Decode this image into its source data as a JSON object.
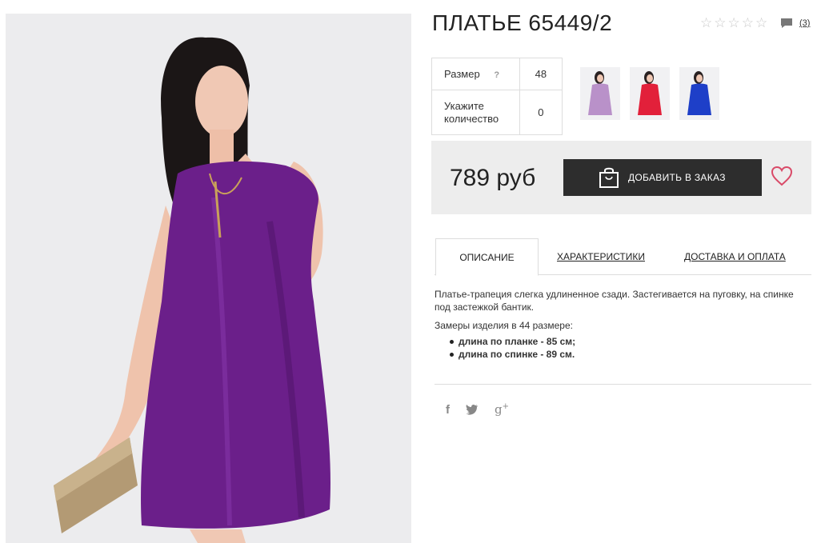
{
  "product": {
    "title": "ПЛАТЬЕ 65449/2",
    "rating_icons": [
      "star-empty",
      "star-empty",
      "star-empty",
      "star-empty",
      "star-empty"
    ],
    "reviews_count": "(3)"
  },
  "options": {
    "size_label": "Размер",
    "size_help": "?",
    "size_value": "48",
    "qty_label": "Укажите количество",
    "qty_value": "0"
  },
  "thumbnails": [
    {
      "name": "lilac",
      "color": "#b991c9"
    },
    {
      "name": "red",
      "color": "#e2203a"
    },
    {
      "name": "blue",
      "color": "#1e3fc8"
    }
  ],
  "buy": {
    "price": "789 руб",
    "button_label": "ДОБАВИТЬ В ЗАКАЗ",
    "wishlist_icon": "heart-icon",
    "accent_color": "#d94a68"
  },
  "tabs": [
    {
      "label": "ОПИСАНИЕ",
      "active": true
    },
    {
      "label": "ХАРАКТЕРИСТИКИ",
      "active": false
    },
    {
      "label": "ДОСТАВКА И ОПЛАТА",
      "active": false
    }
  ],
  "description": {
    "text": "Платье-трапеция слегка удлиненное сзади. Застегивается на пуговку, на спинке под застежкой бантик.",
    "measurements_title": "Замеры изделия в 44 размере:",
    "measurements": [
      "длина по планке - 85 см;",
      "длина по спинке - 89 см."
    ]
  },
  "social": [
    {
      "name": "facebook-icon",
      "glyph": "f"
    },
    {
      "name": "twitter-icon",
      "glyph": "🐦"
    },
    {
      "name": "google-plus-icon",
      "glyph": "g+"
    }
  ],
  "colors": {
    "dress": "#6b1f8a",
    "button_bg": "#2d2d2d",
    "buybox_bg": "#ededed"
  }
}
